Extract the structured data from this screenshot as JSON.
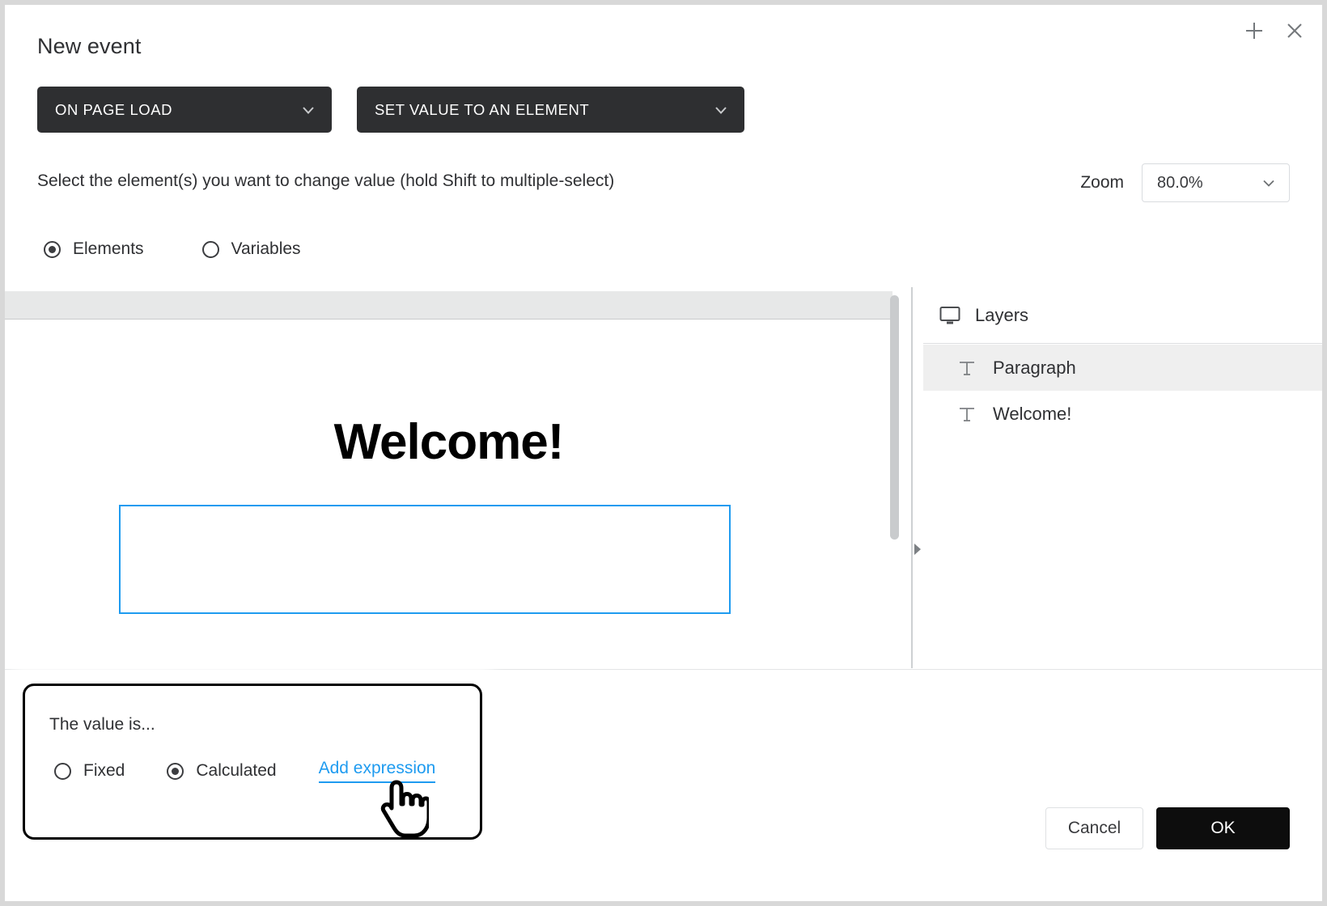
{
  "window": {
    "title": "New event",
    "add_icon": "plus-icon",
    "close_icon": "close-icon"
  },
  "event": {
    "trigger": {
      "label": "ON PAGE LOAD",
      "chevron": "chevron-down-icon"
    },
    "action": {
      "label": "SET VALUE TO AN ELEMENT",
      "chevron": "chevron-down-icon"
    }
  },
  "instruction": "Select the element(s) you want to change value (hold Shift to multiple-select)",
  "zoom": {
    "label": "Zoom",
    "value": "80.0%",
    "chevron": "chevron-down-icon",
    "options": [
      "80.0%"
    ]
  },
  "source_mode": {
    "options": [
      {
        "label": "Elements",
        "selected": true
      },
      {
        "label": "Variables",
        "selected": false
      }
    ]
  },
  "canvas": {
    "heading": "Welcome!",
    "paragraph_placeholder": "",
    "selection_color": "#1e9bf0"
  },
  "layers": {
    "title": "Layers",
    "screen_icon": "monitor-icon",
    "items": [
      {
        "name": "Paragraph",
        "icon": "text-icon",
        "selected": true
      },
      {
        "name": "Welcome!",
        "icon": "text-icon",
        "selected": false
      }
    ]
  },
  "value_popover": {
    "title": "The value is...",
    "options": [
      {
        "label": "Fixed",
        "selected": false
      },
      {
        "label": "Calculated",
        "selected": true
      }
    ],
    "link": "Add expression",
    "link_color": "#1e9bf0"
  },
  "footer": {
    "cancel_label": "Cancel",
    "ok_label": "OK"
  },
  "cursor": {
    "type": "pointing-hand-cursor"
  }
}
